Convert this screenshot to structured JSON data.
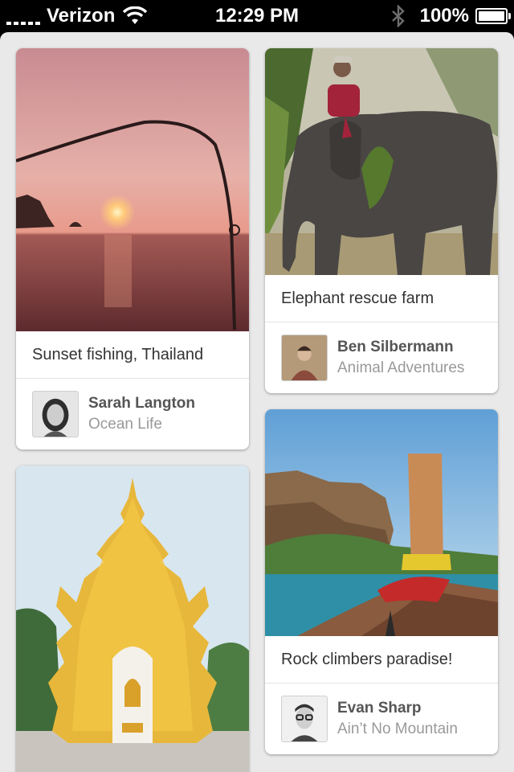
{
  "status_bar": {
    "carrier": "Verizon",
    "time": "12:29 PM",
    "battery": "100%",
    "battery_level": 1.0,
    "icons": [
      "signal-icon",
      "wifi-icon",
      "bluetooth-icon",
      "battery-icon"
    ]
  },
  "pins": [
    {
      "description": "Sunset fishing, Thailand",
      "author": "Sarah Langton",
      "board": "Ocean Life"
    },
    {
      "description": "Elephant rescue farm",
      "author": "Ben Silbermann",
      "board": "Animal Adventures"
    },
    {
      "description": "",
      "author": "",
      "board": ""
    },
    {
      "description": "Rock climbers paradise!",
      "author": "Evan Sharp",
      "board": "Ain’t No Mountain"
    }
  ],
  "colors": {
    "board_background": "#e9e9e9",
    "card": "#ffffff",
    "status_bar": "#000000"
  }
}
